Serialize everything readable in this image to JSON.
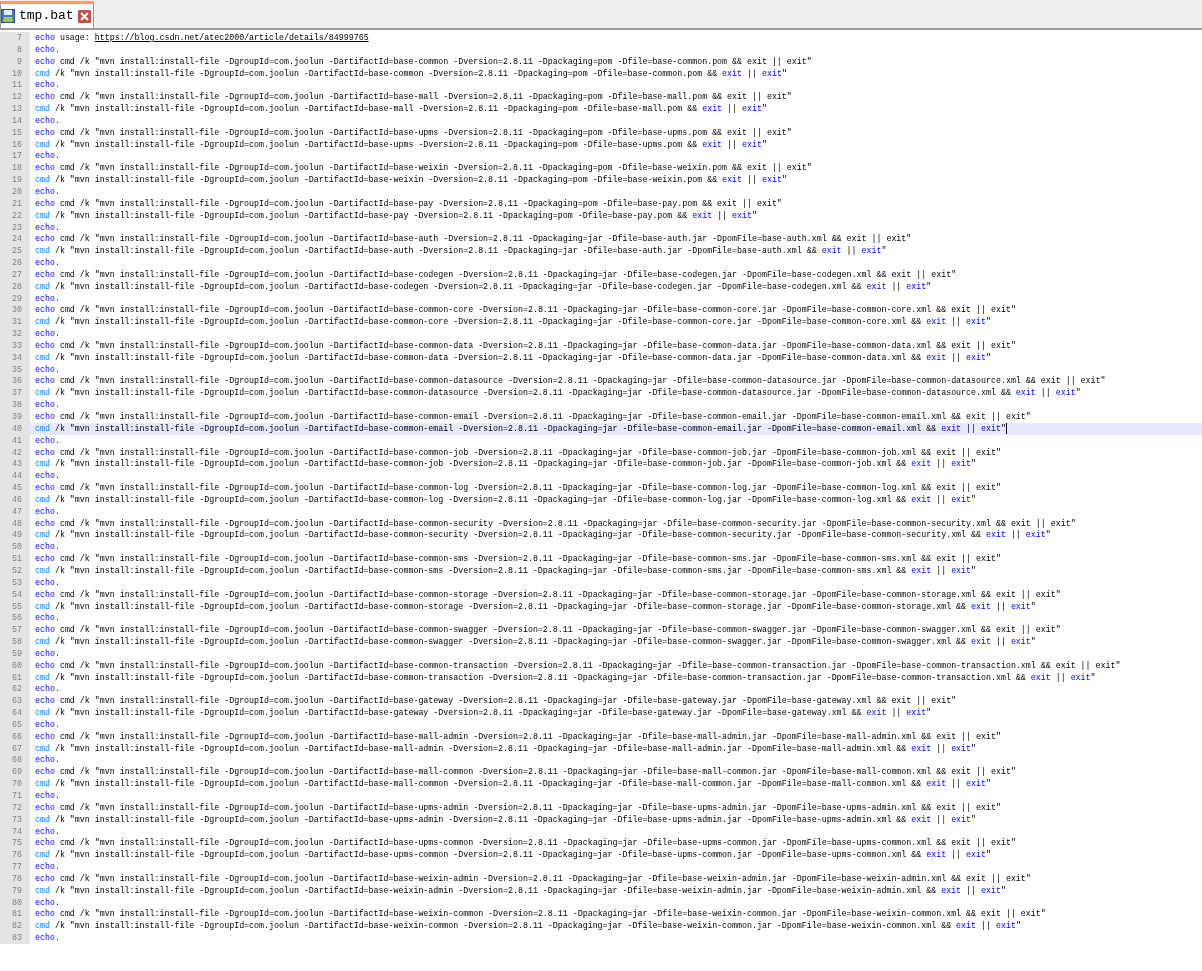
{
  "tabs": [
    {
      "label": "tmp.bat",
      "selected": true
    }
  ],
  "lines": [
    {
      "number": "7",
      "current": false,
      "segments": [
        {
          "kind": "keyword",
          "text": "echo"
        },
        {
          "kind": "plain",
          "text": " usage: "
        },
        {
          "kind": "link",
          "text": "https://blog.csdn.net/atec2000/article/details/84999765"
        }
      ]
    },
    {
      "number": "8",
      "current": false,
      "segments": [
        {
          "kind": "keyword",
          "text": "echo."
        }
      ]
    },
    {
      "number": "9",
      "current": false,
      "segments": [
        {
          "kind": "keyword",
          "text": "echo"
        },
        {
          "kind": "plain",
          "text": " cmd /k \"mvn install:install-file -DgroupId=com.joolun -DartifactId=base-common -Dversion=2.8.11 -Dpackaging=pom -Dfile=base-common.pom && exit || exit\""
        }
      ]
    },
    {
      "number": "10",
      "current": false,
      "segments": [
        {
          "kind": "command",
          "text": "cmd"
        },
        {
          "kind": "plain",
          "text": " /k \"mvn install:install-file -DgroupId=com.joolun -DartifactId=base-common -Dversion=2.8.11 -Dpackaging=pom -Dfile=base-common.pom && "
        },
        {
          "kind": "keyword",
          "text": "exit"
        },
        {
          "kind": "plain",
          "text": " || "
        },
        {
          "kind": "keyword",
          "text": "exit"
        },
        {
          "kind": "plain",
          "text": "\""
        }
      ]
    },
    {
      "number": "11",
      "current": false,
      "segments": [
        {
          "kind": "keyword",
          "text": "echo."
        }
      ]
    },
    {
      "number": "12",
      "current": false,
      "segments": [
        {
          "kind": "keyword",
          "text": "echo"
        },
        {
          "kind": "plain",
          "text": " cmd /k \"mvn install:install-file -DgroupId=com.joolun -DartifactId=base-mall -Dversion=2.8.11 -Dpackaging=pom -Dfile=base-mall.pom && exit || exit\""
        }
      ]
    },
    {
      "number": "13",
      "current": false,
      "segments": [
        {
          "kind": "command",
          "text": "cmd"
        },
        {
          "kind": "plain",
          "text": " /k \"mvn install:install-file -DgroupId=com.joolun -DartifactId=base-mall -Dversion=2.8.11 -Dpackaging=pom -Dfile=base-mall.pom && "
        },
        {
          "kind": "keyword",
          "text": "exit"
        },
        {
          "kind": "plain",
          "text": " || "
        },
        {
          "kind": "keyword",
          "text": "exit"
        },
        {
          "kind": "plain",
          "text": "\""
        }
      ]
    },
    {
      "number": "14",
      "current": false,
      "segments": [
        {
          "kind": "keyword",
          "text": "echo."
        }
      ]
    },
    {
      "number": "15",
      "current": false,
      "segments": [
        {
          "kind": "keyword",
          "text": "echo"
        },
        {
          "kind": "plain",
          "text": " cmd /k \"mvn install:install-file -DgroupId=com.joolun -DartifactId=base-upms -Dversion=2.8.11 -Dpackaging=pom -Dfile=base-upms.pom && exit || exit\""
        }
      ]
    },
    {
      "number": "16",
      "current": false,
      "segments": [
        {
          "kind": "command",
          "text": "cmd"
        },
        {
          "kind": "plain",
          "text": " /k \"mvn install:install-file -DgroupId=com.joolun -DartifactId=base-upms -Dversion=2.8.11 -Dpackaging=pom -Dfile=base-upms.pom && "
        },
        {
          "kind": "keyword",
          "text": "exit"
        },
        {
          "kind": "plain",
          "text": " || "
        },
        {
          "kind": "keyword",
          "text": "exit"
        },
        {
          "kind": "plain",
          "text": "\""
        }
      ]
    },
    {
      "number": "17",
      "current": false,
      "segments": [
        {
          "kind": "keyword",
          "text": "echo."
        }
      ]
    },
    {
      "number": "18",
      "current": false,
      "segments": [
        {
          "kind": "keyword",
          "text": "echo"
        },
        {
          "kind": "plain",
          "text": " cmd /k \"mvn install:install-file -DgroupId=com.joolun -DartifactId=base-weixin -Dversion=2.8.11 -Dpackaging=pom -Dfile=base-weixin.pom && exit || exit\""
        }
      ]
    },
    {
      "number": "19",
      "current": false,
      "segments": [
        {
          "kind": "command",
          "text": "cmd"
        },
        {
          "kind": "plain",
          "text": " /k \"mvn install:install-file -DgroupId=com.joolun -DartifactId=base-weixin -Dversion=2.8.11 -Dpackaging=pom -Dfile=base-weixin.pom && "
        },
        {
          "kind": "keyword",
          "text": "exit"
        },
        {
          "kind": "plain",
          "text": " || "
        },
        {
          "kind": "keyword",
          "text": "exit"
        },
        {
          "kind": "plain",
          "text": "\""
        }
      ]
    },
    {
      "number": "20",
      "current": false,
      "segments": [
        {
          "kind": "keyword",
          "text": "echo."
        }
      ]
    },
    {
      "number": "21",
      "current": false,
      "segments": [
        {
          "kind": "keyword",
          "text": "echo"
        },
        {
          "kind": "plain",
          "text": " cmd /k \"mvn install:install-file -DgroupId=com.joolun -DartifactId=base-pay -Dversion=2.8.11 -Dpackaging=pom -Dfile=base-pay.pom && exit || exit\""
        }
      ]
    },
    {
      "number": "22",
      "current": false,
      "segments": [
        {
          "kind": "command",
          "text": "cmd"
        },
        {
          "kind": "plain",
          "text": " /k \"mvn install:install-file -DgroupId=com.joolun -DartifactId=base-pay -Dversion=2.8.11 -Dpackaging=pom -Dfile=base-pay.pom && "
        },
        {
          "kind": "keyword",
          "text": "exit"
        },
        {
          "kind": "plain",
          "text": " || "
        },
        {
          "kind": "keyword",
          "text": "exit"
        },
        {
          "kind": "plain",
          "text": "\""
        }
      ]
    },
    {
      "number": "23",
      "current": false,
      "segments": [
        {
          "kind": "keyword",
          "text": "echo."
        }
      ]
    },
    {
      "number": "24",
      "current": false,
      "segments": [
        {
          "kind": "keyword",
          "text": "echo"
        },
        {
          "kind": "plain",
          "text": " cmd /k \"mvn install:install-file -DgroupId=com.joolun -DartifactId=base-auth -Dversion=2.8.11 -Dpackaging=jar -Dfile=base-auth.jar -DpomFile=base-auth.xml && exit || exit\""
        }
      ]
    },
    {
      "number": "25",
      "current": false,
      "segments": [
        {
          "kind": "command",
          "text": "cmd"
        },
        {
          "kind": "plain",
          "text": " /k \"mvn install:install-file -DgroupId=com.joolun -DartifactId=base-auth -Dversion=2.8.11 -Dpackaging=jar -Dfile=base-auth.jar -DpomFile=base-auth.xml && "
        },
        {
          "kind": "keyword",
          "text": "exit"
        },
        {
          "kind": "plain",
          "text": " || "
        },
        {
          "kind": "keyword",
          "text": "exit"
        },
        {
          "kind": "plain",
          "text": "\""
        }
      ]
    },
    {
      "number": "26",
      "current": false,
      "segments": [
        {
          "kind": "keyword",
          "text": "echo."
        }
      ]
    },
    {
      "number": "27",
      "current": false,
      "segments": [
        {
          "kind": "keyword",
          "text": "echo"
        },
        {
          "kind": "plain",
          "text": " cmd /k \"mvn install:install-file -DgroupId=com.joolun -DartifactId=base-codegen -Dversion=2.8.11 -Dpackaging=jar -Dfile=base-codegen.jar -DpomFile=base-codegen.xml && exit || exit\""
        }
      ]
    },
    {
      "number": "28",
      "current": false,
      "segments": [
        {
          "kind": "command",
          "text": "cmd"
        },
        {
          "kind": "plain",
          "text": " /k \"mvn install:install-file -DgroupId=com.joolun -DartifactId=base-codegen -Dversion=2.8.11 -Dpackaging=jar -Dfile=base-codegen.jar -DpomFile=base-codegen.xml && "
        },
        {
          "kind": "keyword",
          "text": "exit"
        },
        {
          "kind": "plain",
          "text": " || "
        },
        {
          "kind": "keyword",
          "text": "exit"
        },
        {
          "kind": "plain",
          "text": "\""
        }
      ]
    },
    {
      "number": "29",
      "current": false,
      "segments": [
        {
          "kind": "keyword",
          "text": "echo."
        }
      ]
    },
    {
      "number": "30",
      "current": false,
      "segments": [
        {
          "kind": "keyword",
          "text": "echo"
        },
        {
          "kind": "plain",
          "text": " cmd /k \"mvn install:install-file -DgroupId=com.joolun -DartifactId=base-common-core -Dversion=2.8.11 -Dpackaging=jar -Dfile=base-common-core.jar -DpomFile=base-common-core.xml && exit || exit\""
        }
      ]
    },
    {
      "number": "31",
      "current": false,
      "segments": [
        {
          "kind": "command",
          "text": "cmd"
        },
        {
          "kind": "plain",
          "text": " /k \"mvn install:install-file -DgroupId=com.joolun -DartifactId=base-common-core -Dversion=2.8.11 -Dpackaging=jar -Dfile=base-common-core.jar -DpomFile=base-common-core.xml && "
        },
        {
          "kind": "keyword",
          "text": "exit"
        },
        {
          "kind": "plain",
          "text": " || "
        },
        {
          "kind": "keyword",
          "text": "exit"
        },
        {
          "kind": "plain",
          "text": "\""
        }
      ]
    },
    {
      "number": "32",
      "current": false,
      "segments": [
        {
          "kind": "keyword",
          "text": "echo."
        }
      ]
    },
    {
      "number": "33",
      "current": false,
      "segments": [
        {
          "kind": "keyword",
          "text": "echo"
        },
        {
          "kind": "plain",
          "text": " cmd /k \"mvn install:install-file -DgroupId=com.joolun -DartifactId=base-common-data -Dversion=2.8.11 -Dpackaging=jar -Dfile=base-common-data.jar -DpomFile=base-common-data.xml && exit || exit\""
        }
      ]
    },
    {
      "number": "34",
      "current": false,
      "segments": [
        {
          "kind": "command",
          "text": "cmd"
        },
        {
          "kind": "plain",
          "text": " /k \"mvn install:install-file -DgroupId=com.joolun -DartifactId=base-common-data -Dversion=2.8.11 -Dpackaging=jar -Dfile=base-common-data.jar -DpomFile=base-common-data.xml && "
        },
        {
          "kind": "keyword",
          "text": "exit"
        },
        {
          "kind": "plain",
          "text": " || "
        },
        {
          "kind": "keyword",
          "text": "exit"
        },
        {
          "kind": "plain",
          "text": "\""
        }
      ]
    },
    {
      "number": "35",
      "current": false,
      "segments": [
        {
          "kind": "keyword",
          "text": "echo."
        }
      ]
    },
    {
      "number": "36",
      "current": false,
      "segments": [
        {
          "kind": "keyword",
          "text": "echo"
        },
        {
          "kind": "plain",
          "text": " cmd /k \"mvn install:install-file -DgroupId=com.joolun -DartifactId=base-common-datasource -Dversion=2.8.11 -Dpackaging=jar -Dfile=base-common-datasource.jar -DpomFile=base-common-datasource.xml && exit || exit\""
        }
      ]
    },
    {
      "number": "37",
      "current": false,
      "segments": [
        {
          "kind": "command",
          "text": "cmd"
        },
        {
          "kind": "plain",
          "text": " /k \"mvn install:install-file -DgroupId=com.joolun -DartifactId=base-common-datasource -Dversion=2.8.11 -Dpackaging=jar -Dfile=base-common-datasource.jar -DpomFile=base-common-datasource.xml && "
        },
        {
          "kind": "keyword",
          "text": "exit"
        },
        {
          "kind": "plain",
          "text": " || "
        },
        {
          "kind": "keyword",
          "text": "exit"
        },
        {
          "kind": "plain",
          "text": "\""
        }
      ]
    },
    {
      "number": "38",
      "current": false,
      "segments": [
        {
          "kind": "keyword",
          "text": "echo."
        }
      ]
    },
    {
      "number": "39",
      "current": false,
      "segments": [
        {
          "kind": "keyword",
          "text": "echo"
        },
        {
          "kind": "plain",
          "text": " cmd /k \"mvn install:install-file -DgroupId=com.joolun -DartifactId=base-common-email -Dversion=2.8.11 -Dpackaging=jar -Dfile=base-common-email.jar -DpomFile=base-common-email.xml && exit || exit\""
        }
      ]
    },
    {
      "number": "40",
      "current": true,
      "segments": [
        {
          "kind": "command",
          "text": "cmd"
        },
        {
          "kind": "plain",
          "text": " /k \"mvn install:install-file -DgroupId=com.joolun -DartifactId=base-common-email -Dversion=2.8.11 -Dpackaging=jar -Dfile=base-common-email.jar -DpomFile=base-common-email.xml && "
        },
        {
          "kind": "keyword",
          "text": "exit"
        },
        {
          "kind": "plain",
          "text": " || "
        },
        {
          "kind": "keyword",
          "text": "exit"
        },
        {
          "kind": "plain",
          "text": "\""
        }
      ]
    },
    {
      "number": "41",
      "current": false,
      "segments": [
        {
          "kind": "keyword",
          "text": "echo."
        }
      ]
    },
    {
      "number": "42",
      "current": false,
      "segments": [
        {
          "kind": "keyword",
          "text": "echo"
        },
        {
          "kind": "plain",
          "text": " cmd /k \"mvn install:install-file -DgroupId=com.joolun -DartifactId=base-common-job -Dversion=2.8.11 -Dpackaging=jar -Dfile=base-common-job.jar -DpomFile=base-common-job.xml && exit || exit\""
        }
      ]
    },
    {
      "number": "43",
      "current": false,
      "segments": [
        {
          "kind": "command",
          "text": "cmd"
        },
        {
          "kind": "plain",
          "text": " /k \"mvn install:install-file -DgroupId=com.joolun -DartifactId=base-common-job -Dversion=2.8.11 -Dpackaging=jar -Dfile=base-common-job.jar -DpomFile=base-common-job.xml && "
        },
        {
          "kind": "keyword",
          "text": "exit"
        },
        {
          "kind": "plain",
          "text": " || "
        },
        {
          "kind": "keyword",
          "text": "exit"
        },
        {
          "kind": "plain",
          "text": "\""
        }
      ]
    },
    {
      "number": "44",
      "current": false,
      "segments": [
        {
          "kind": "keyword",
          "text": "echo."
        }
      ]
    },
    {
      "number": "45",
      "current": false,
      "segments": [
        {
          "kind": "keyword",
          "text": "echo"
        },
        {
          "kind": "plain",
          "text": " cmd /k \"mvn install:install-file -DgroupId=com.joolun -DartifactId=base-common-log -Dversion=2.8.11 -Dpackaging=jar -Dfile=base-common-log.jar -DpomFile=base-common-log.xml && exit || exit\""
        }
      ]
    },
    {
      "number": "46",
      "current": false,
      "segments": [
        {
          "kind": "command",
          "text": "cmd"
        },
        {
          "kind": "plain",
          "text": " /k \"mvn install:install-file -DgroupId=com.joolun -DartifactId=base-common-log -Dversion=2.8.11 -Dpackaging=jar -Dfile=base-common-log.jar -DpomFile=base-common-log.xml && "
        },
        {
          "kind": "keyword",
          "text": "exit"
        },
        {
          "kind": "plain",
          "text": " || "
        },
        {
          "kind": "keyword",
          "text": "exit"
        },
        {
          "kind": "plain",
          "text": "\""
        }
      ]
    },
    {
      "number": "47",
      "current": false,
      "segments": [
        {
          "kind": "keyword",
          "text": "echo."
        }
      ]
    },
    {
      "number": "48",
      "current": false,
      "segments": [
        {
          "kind": "keyword",
          "text": "echo"
        },
        {
          "kind": "plain",
          "text": " cmd /k \"mvn install:install-file -DgroupId=com.joolun -DartifactId=base-common-security -Dversion=2.8.11 -Dpackaging=jar -Dfile=base-common-security.jar -DpomFile=base-common-security.xml && exit || exit\""
        }
      ]
    },
    {
      "number": "49",
      "current": false,
      "segments": [
        {
          "kind": "command",
          "text": "cmd"
        },
        {
          "kind": "plain",
          "text": " /k \"mvn install:install-file -DgroupId=com.joolun -DartifactId=base-common-security -Dversion=2.8.11 -Dpackaging=jar -Dfile=base-common-security.jar -DpomFile=base-common-security.xml && "
        },
        {
          "kind": "keyword",
          "text": "exit"
        },
        {
          "kind": "plain",
          "text": " || "
        },
        {
          "kind": "keyword",
          "text": "exit"
        },
        {
          "kind": "plain",
          "text": "\""
        }
      ]
    },
    {
      "number": "50",
      "current": false,
      "segments": [
        {
          "kind": "keyword",
          "text": "echo."
        }
      ]
    },
    {
      "number": "51",
      "current": false,
      "segments": [
        {
          "kind": "keyword",
          "text": "echo"
        },
        {
          "kind": "plain",
          "text": " cmd /k \"mvn install:install-file -DgroupId=com.joolun -DartifactId=base-common-sms -Dversion=2.8.11 -Dpackaging=jar -Dfile=base-common-sms.jar -DpomFile=base-common-sms.xml && exit || exit\""
        }
      ]
    },
    {
      "number": "52",
      "current": false,
      "segments": [
        {
          "kind": "command",
          "text": "cmd"
        },
        {
          "kind": "plain",
          "text": " /k \"mvn install:install-file -DgroupId=com.joolun -DartifactId=base-common-sms -Dversion=2.8.11 -Dpackaging=jar -Dfile=base-common-sms.jar -DpomFile=base-common-sms.xml && "
        },
        {
          "kind": "keyword",
          "text": "exit"
        },
        {
          "kind": "plain",
          "text": " || "
        },
        {
          "kind": "keyword",
          "text": "exit"
        },
        {
          "kind": "plain",
          "text": "\""
        }
      ]
    },
    {
      "number": "53",
      "current": false,
      "segments": [
        {
          "kind": "keyword",
          "text": "echo."
        }
      ]
    },
    {
      "number": "54",
      "current": false,
      "segments": [
        {
          "kind": "keyword",
          "text": "echo"
        },
        {
          "kind": "plain",
          "text": " cmd /k \"mvn install:install-file -DgroupId=com.joolun -DartifactId=base-common-storage -Dversion=2.8.11 -Dpackaging=jar -Dfile=base-common-storage.jar -DpomFile=base-common-storage.xml && exit || exit\""
        }
      ]
    },
    {
      "number": "55",
      "current": false,
      "segments": [
        {
          "kind": "command",
          "text": "cmd"
        },
        {
          "kind": "plain",
          "text": " /k \"mvn install:install-file -DgroupId=com.joolun -DartifactId=base-common-storage -Dversion=2.8.11 -Dpackaging=jar -Dfile=base-common-storage.jar -DpomFile=base-common-storage.xml && "
        },
        {
          "kind": "keyword",
          "text": "exit"
        },
        {
          "kind": "plain",
          "text": " || "
        },
        {
          "kind": "keyword",
          "text": "exit"
        },
        {
          "kind": "plain",
          "text": "\""
        }
      ]
    },
    {
      "number": "56",
      "current": false,
      "segments": [
        {
          "kind": "keyword",
          "text": "echo."
        }
      ]
    },
    {
      "number": "57",
      "current": false,
      "segments": [
        {
          "kind": "keyword",
          "text": "echo"
        },
        {
          "kind": "plain",
          "text": " cmd /k \"mvn install:install-file -DgroupId=com.joolun -DartifactId=base-common-swagger -Dversion=2.8.11 -Dpackaging=jar -Dfile=base-common-swagger.jar -DpomFile=base-common-swagger.xml && exit || exit\""
        }
      ]
    },
    {
      "number": "58",
      "current": false,
      "segments": [
        {
          "kind": "command",
          "text": "cmd"
        },
        {
          "kind": "plain",
          "text": " /k \"mvn install:install-file -DgroupId=com.joolun -DartifactId=base-common-swagger -Dversion=2.8.11 -Dpackaging=jar -Dfile=base-common-swagger.jar -DpomFile=base-common-swagger.xml && "
        },
        {
          "kind": "keyword",
          "text": "exit"
        },
        {
          "kind": "plain",
          "text": " || "
        },
        {
          "kind": "keyword",
          "text": "exit"
        },
        {
          "kind": "plain",
          "text": "\""
        }
      ]
    },
    {
      "number": "59",
      "current": false,
      "segments": [
        {
          "kind": "keyword",
          "text": "echo."
        }
      ]
    },
    {
      "number": "60",
      "current": false,
      "segments": [
        {
          "kind": "keyword",
          "text": "echo"
        },
        {
          "kind": "plain",
          "text": " cmd /k \"mvn install:install-file -DgroupId=com.joolun -DartifactId=base-common-transaction -Dversion=2.8.11 -Dpackaging=jar -Dfile=base-common-transaction.jar -DpomFile=base-common-transaction.xml && exit || exit\""
        }
      ]
    },
    {
      "number": "61",
      "current": false,
      "segments": [
        {
          "kind": "command",
          "text": "cmd"
        },
        {
          "kind": "plain",
          "text": " /k \"mvn install:install-file -DgroupId=com.joolun -DartifactId=base-common-transaction -Dversion=2.8.11 -Dpackaging=jar -Dfile=base-common-transaction.jar -DpomFile=base-common-transaction.xml && "
        },
        {
          "kind": "keyword",
          "text": "exit"
        },
        {
          "kind": "plain",
          "text": " || "
        },
        {
          "kind": "keyword",
          "text": "exit"
        },
        {
          "kind": "plain",
          "text": "\""
        }
      ]
    },
    {
      "number": "62",
      "current": false,
      "segments": [
        {
          "kind": "keyword",
          "text": "echo."
        }
      ]
    },
    {
      "number": "63",
      "current": false,
      "segments": [
        {
          "kind": "keyword",
          "text": "echo"
        },
        {
          "kind": "plain",
          "text": " cmd /k \"mvn install:install-file -DgroupId=com.joolun -DartifactId=base-gateway -Dversion=2.8.11 -Dpackaging=jar -Dfile=base-gateway.jar -DpomFile=base-gateway.xml && exit || exit\""
        }
      ]
    },
    {
      "number": "64",
      "current": false,
      "segments": [
        {
          "kind": "command",
          "text": "cmd"
        },
        {
          "kind": "plain",
          "text": " /k \"mvn install:install-file -DgroupId=com.joolun -DartifactId=base-gateway -Dversion=2.8.11 -Dpackaging=jar -Dfile=base-gateway.jar -DpomFile=base-gateway.xml && "
        },
        {
          "kind": "keyword",
          "text": "exit"
        },
        {
          "kind": "plain",
          "text": " || "
        },
        {
          "kind": "keyword",
          "text": "exit"
        },
        {
          "kind": "plain",
          "text": "\""
        }
      ]
    },
    {
      "number": "65",
      "current": false,
      "segments": [
        {
          "kind": "keyword",
          "text": "echo."
        }
      ]
    },
    {
      "number": "66",
      "current": false,
      "segments": [
        {
          "kind": "keyword",
          "text": "echo"
        },
        {
          "kind": "plain",
          "text": " cmd /k \"mvn install:install-file -DgroupId=com.joolun -DartifactId=base-mall-admin -Dversion=2.8.11 -Dpackaging=jar -Dfile=base-mall-admin.jar -DpomFile=base-mall-admin.xml && exit || exit\""
        }
      ]
    },
    {
      "number": "67",
      "current": false,
      "segments": [
        {
          "kind": "command",
          "text": "cmd"
        },
        {
          "kind": "plain",
          "text": " /k \"mvn install:install-file -DgroupId=com.joolun -DartifactId=base-mall-admin -Dversion=2.8.11 -Dpackaging=jar -Dfile=base-mall-admin.jar -DpomFile=base-mall-admin.xml && "
        },
        {
          "kind": "keyword",
          "text": "exit"
        },
        {
          "kind": "plain",
          "text": " || "
        },
        {
          "kind": "keyword",
          "text": "exit"
        },
        {
          "kind": "plain",
          "text": "\""
        }
      ]
    },
    {
      "number": "68",
      "current": false,
      "segments": [
        {
          "kind": "keyword",
          "text": "echo."
        }
      ]
    },
    {
      "number": "69",
      "current": false,
      "segments": [
        {
          "kind": "keyword",
          "text": "echo"
        },
        {
          "kind": "plain",
          "text": " cmd /k \"mvn install:install-file -DgroupId=com.joolun -DartifactId=base-mall-common -Dversion=2.8.11 -Dpackaging=jar -Dfile=base-mall-common.jar -DpomFile=base-mall-common.xml && exit || exit\""
        }
      ]
    },
    {
      "number": "70",
      "current": false,
      "segments": [
        {
          "kind": "command",
          "text": "cmd"
        },
        {
          "kind": "plain",
          "text": " /k \"mvn install:install-file -DgroupId=com.joolun -DartifactId=base-mall-common -Dversion=2.8.11 -Dpackaging=jar -Dfile=base-mall-common.jar -DpomFile=base-mall-common.xml && "
        },
        {
          "kind": "keyword",
          "text": "exit"
        },
        {
          "kind": "plain",
          "text": " || "
        },
        {
          "kind": "keyword",
          "text": "exit"
        },
        {
          "kind": "plain",
          "text": "\""
        }
      ]
    },
    {
      "number": "71",
      "current": false,
      "segments": [
        {
          "kind": "keyword",
          "text": "echo."
        }
      ]
    },
    {
      "number": "72",
      "current": false,
      "segments": [
        {
          "kind": "keyword",
          "text": "echo"
        },
        {
          "kind": "plain",
          "text": " cmd /k \"mvn install:install-file -DgroupId=com.joolun -DartifactId=base-upms-admin -Dversion=2.8.11 -Dpackaging=jar -Dfile=base-upms-admin.jar -DpomFile=base-upms-admin.xml && exit || exit\""
        }
      ]
    },
    {
      "number": "73",
      "current": false,
      "segments": [
        {
          "kind": "command",
          "text": "cmd"
        },
        {
          "kind": "plain",
          "text": " /k \"mvn install:install-file -DgroupId=com.joolun -DartifactId=base-upms-admin -Dversion=2.8.11 -Dpackaging=jar -Dfile=base-upms-admin.jar -DpomFile=base-upms-admin.xml && "
        },
        {
          "kind": "keyword",
          "text": "exit"
        },
        {
          "kind": "plain",
          "text": " || "
        },
        {
          "kind": "keyword",
          "text": "exit"
        },
        {
          "kind": "plain",
          "text": "\""
        }
      ]
    },
    {
      "number": "74",
      "current": false,
      "segments": [
        {
          "kind": "keyword",
          "text": "echo."
        }
      ]
    },
    {
      "number": "75",
      "current": false,
      "segments": [
        {
          "kind": "keyword",
          "text": "echo"
        },
        {
          "kind": "plain",
          "text": " cmd /k \"mvn install:install-file -DgroupId=com.joolun -DartifactId=base-upms-common -Dversion=2.8.11 -Dpackaging=jar -Dfile=base-upms-common.jar -DpomFile=base-upms-common.xml && exit || exit\""
        }
      ]
    },
    {
      "number": "76",
      "current": false,
      "segments": [
        {
          "kind": "command",
          "text": "cmd"
        },
        {
          "kind": "plain",
          "text": " /k \"mvn install:install-file -DgroupId=com.joolun -DartifactId=base-upms-common -Dversion=2.8.11 -Dpackaging=jar -Dfile=base-upms-common.jar -DpomFile=base-upms-common.xml && "
        },
        {
          "kind": "keyword",
          "text": "exit"
        },
        {
          "kind": "plain",
          "text": " || "
        },
        {
          "kind": "keyword",
          "text": "exit"
        },
        {
          "kind": "plain",
          "text": "\""
        }
      ]
    },
    {
      "number": "77",
      "current": false,
      "segments": [
        {
          "kind": "keyword",
          "text": "echo."
        }
      ]
    },
    {
      "number": "78",
      "current": false,
      "segments": [
        {
          "kind": "keyword",
          "text": "echo"
        },
        {
          "kind": "plain",
          "text": " cmd /k \"mvn install:install-file -DgroupId=com.joolun -DartifactId=base-weixin-admin -Dversion=2.8.11 -Dpackaging=jar -Dfile=base-weixin-admin.jar -DpomFile=base-weixin-admin.xml && exit || exit\""
        }
      ]
    },
    {
      "number": "79",
      "current": false,
      "segments": [
        {
          "kind": "command",
          "text": "cmd"
        },
        {
          "kind": "plain",
          "text": " /k \"mvn install:install-file -DgroupId=com.joolun -DartifactId=base-weixin-admin -Dversion=2.8.11 -Dpackaging=jar -Dfile=base-weixin-admin.jar -DpomFile=base-weixin-admin.xml && "
        },
        {
          "kind": "keyword",
          "text": "exit"
        },
        {
          "kind": "plain",
          "text": " || "
        },
        {
          "kind": "keyword",
          "text": "exit"
        },
        {
          "kind": "plain",
          "text": "\""
        }
      ]
    },
    {
      "number": "80",
      "current": false,
      "segments": [
        {
          "kind": "keyword",
          "text": "echo."
        }
      ]
    },
    {
      "number": "81",
      "current": false,
      "segments": [
        {
          "kind": "keyword",
          "text": "echo"
        },
        {
          "kind": "plain",
          "text": " cmd /k \"mvn install:install-file -DgroupId=com.joolun -DartifactId=base-weixin-common -Dversion=2.8.11 -Dpackaging=jar -Dfile=base-weixin-common.jar -DpomFile=base-weixin-common.xml && exit || exit\""
        }
      ]
    },
    {
      "number": "82",
      "current": false,
      "segments": [
        {
          "kind": "command",
          "text": "cmd"
        },
        {
          "kind": "plain",
          "text": " /k \"mvn install:install-file -DgroupId=com.joolun -DartifactId=base-weixin-common -Dversion=2.8.11 -Dpackaging=jar -Dfile=base-weixin-common.jar -DpomFile=base-weixin-common.xml && "
        },
        {
          "kind": "keyword",
          "text": "exit"
        },
        {
          "kind": "plain",
          "text": " || "
        },
        {
          "kind": "keyword",
          "text": "exit"
        },
        {
          "kind": "plain",
          "text": "\""
        }
      ]
    },
    {
      "number": "83",
      "current": false,
      "segments": [
        {
          "kind": "keyword",
          "text": "echo."
        }
      ]
    }
  ]
}
